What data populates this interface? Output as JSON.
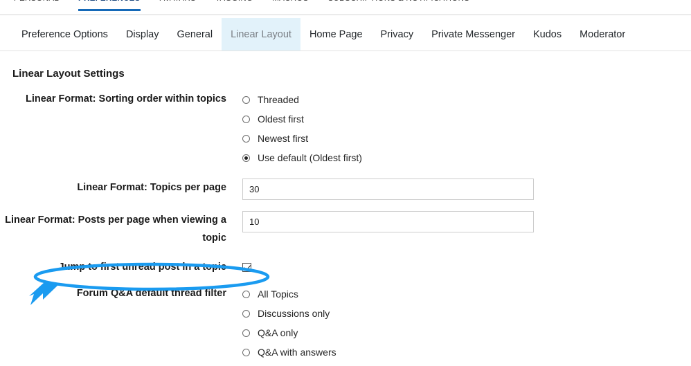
{
  "top_tabs": [
    {
      "label": "PERSONAL",
      "active": false
    },
    {
      "label": "PREFERENCES",
      "active": true
    },
    {
      "label": "AVATARS",
      "active": false
    },
    {
      "label": "TAGGING",
      "active": false
    },
    {
      "label": "MACROS",
      "active": false
    },
    {
      "label": "SUBSCRIPTIONS & NOTIFICATIONS",
      "active": false
    }
  ],
  "sub_tabs": [
    {
      "label": "Preference Options",
      "active": false
    },
    {
      "label": "Display",
      "active": false
    },
    {
      "label": "General",
      "active": false
    },
    {
      "label": "Linear Layout",
      "active": true
    },
    {
      "label": "Home Page",
      "active": false
    },
    {
      "label": "Privacy",
      "active": false
    },
    {
      "label": "Private Messenger",
      "active": false
    },
    {
      "label": "Kudos",
      "active": false
    },
    {
      "label": "Moderator",
      "active": false
    }
  ],
  "page_title": "Linear Layout Settings",
  "fields": {
    "sorting_order": {
      "label": "Linear Format: Sorting order within topics",
      "options": [
        {
          "label": "Threaded",
          "selected": false
        },
        {
          "label": "Oldest first",
          "selected": false
        },
        {
          "label": "Newest first",
          "selected": false
        },
        {
          "label": "Use default (Oldest first)",
          "selected": true
        }
      ]
    },
    "topics_per_page": {
      "label": "Linear Format: Topics per page",
      "value": "30"
    },
    "posts_per_page": {
      "label": "Linear Format: Posts per page when viewing a topic",
      "value": "10"
    },
    "jump_unread": {
      "label": "Jump to first unread post in a topic",
      "checked": true
    },
    "qa_filter": {
      "label": "Forum Q&A default thread filter",
      "options": [
        {
          "label": "All Topics",
          "selected": false
        },
        {
          "label": "Discussions only",
          "selected": false
        },
        {
          "label": "Q&A only",
          "selected": false
        },
        {
          "label": "Q&A with answers",
          "selected": false
        }
      ]
    }
  },
  "annotation": {
    "color": "#1a9bf0",
    "shape": "ellipse-with-arrow",
    "target": "Jump to first unread post in a topic"
  }
}
